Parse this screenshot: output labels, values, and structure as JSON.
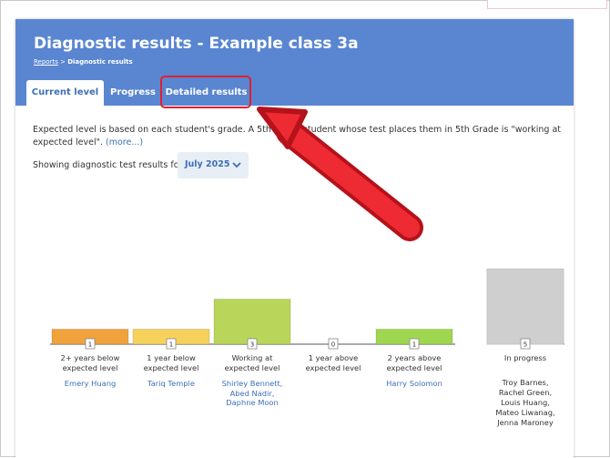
{
  "header": {
    "title": "Diagnostic results - Example class 3a",
    "breadcrumb_link": "Reports",
    "breadcrumb_sep": " > ",
    "breadcrumb_current": "Diagnostic results"
  },
  "tabs": [
    {
      "label": "Current level",
      "active": true
    },
    {
      "label": "Progress",
      "active": false
    },
    {
      "label": "Detailed results",
      "active": false,
      "highlighted": true
    }
  ],
  "description": {
    "text": "Expected level is based on each student's grade. A 5th Grade student whose test places them in 5th Grade is \"working at expected level\".",
    "more_link": "(more...)"
  },
  "filter": {
    "label": "Showing diagnostic test results for",
    "selected": "July 2025"
  },
  "colors": {
    "header": "#5a86d1",
    "accent_link": "#3d6fb8",
    "bar_below_2": "#f0a23c",
    "bar_below_1": "#f6d25c",
    "bar_at": "#b9d65a",
    "bar_above_2": "#9fd64f",
    "bar_in_progress": "#cfcfcf",
    "highlight": "#e0202c"
  },
  "chart_data": {
    "type": "bar",
    "categories": [
      "2+ years below expected level",
      "1 year below expected level",
      "Working at expected level",
      "1 year above expected level",
      "2 years above expected level",
      "In progress"
    ],
    "values": [
      1,
      1,
      3,
      0,
      1,
      5
    ],
    "students": [
      [
        "Emery Huang"
      ],
      [
        "Tariq Temple"
      ],
      [
        "Shirley Bennett,",
        "Abed Nadir,",
        "Daphne Moon"
      ],
      [],
      [
        "Harry Solomon"
      ],
      [
        "Troy Barnes,",
        "Rachel Green,",
        "Louis Huang,",
        "Mateo Liwanag,",
        "Jenna Maroney"
      ]
    ],
    "category_lines": [
      [
        "2+ years below",
        "expected level"
      ],
      [
        "1 year below",
        "expected level"
      ],
      [
        "Working at",
        "expected level"
      ],
      [
        "1 year above",
        "expected level"
      ],
      [
        "2 years above",
        "expected level"
      ],
      [
        "In progress"
      ]
    ],
    "xlabel": "",
    "ylabel": ""
  }
}
